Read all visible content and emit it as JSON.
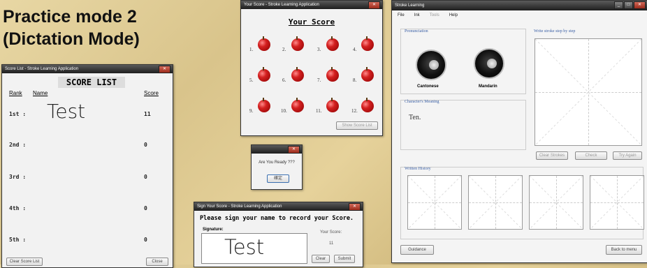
{
  "slide": {
    "title_line1": "Practice mode 2",
    "title_line2": "(Dictation Mode)"
  },
  "score_list_window": {
    "title": "Score List - Stroke Learning Application",
    "heading": "SCORE LIST",
    "col_rank": "Rank",
    "col_name": "Name",
    "col_score": "Score",
    "rows": [
      {
        "rank": "1st :",
        "name": "Test",
        "score": "11"
      },
      {
        "rank": "2nd :",
        "name": "",
        "score": "0"
      },
      {
        "rank": "3rd :",
        "name": "",
        "score": "0"
      },
      {
        "rank": "4th :",
        "name": "",
        "score": "0"
      },
      {
        "rank": "5th :",
        "name": "",
        "score": "0"
      }
    ],
    "clear_button": "Clear Score List",
    "close_button": "Close"
  },
  "your_score_window": {
    "title": "Your Score - Stroke Learning Application",
    "heading": "Your Score",
    "numbers": [
      "1.",
      "2.",
      "3.",
      "4.",
      "5.",
      "6.",
      "7.",
      "8.",
      "9.",
      "10.",
      "11.",
      "12."
    ],
    "show_button": "Show Score List"
  },
  "ready_dialog": {
    "message": "Are You Ready ???",
    "ok_button": "確定"
  },
  "sign_window": {
    "title": "Sign Your Score - Stroke Learning Application",
    "prompt": "Please sign your name to record your Score.",
    "signature_label": "Signature:",
    "signature_value": "Test",
    "your_score_label": "Your Score:",
    "your_score_value": "11",
    "clear_button": "Clear",
    "submit_button": "Submit"
  },
  "main_window": {
    "title": "Stroke Learning",
    "menu": [
      "File",
      "Ink",
      "Tools",
      "Help"
    ],
    "pronunciation_label": "Pronunciation",
    "knobs": [
      {
        "label": "Cantonese"
      },
      {
        "label": "Mandarin"
      }
    ],
    "meaning_label": "Character's Meaning",
    "meaning_value": "Ten.",
    "write_label": "Write stroke step by step",
    "clear_strokes": "Clear Strokes",
    "check": "Check",
    "try_again": "Try Again",
    "history_label": "Written History",
    "guidance_button": "Guidance",
    "back_button": "Back to menu"
  }
}
